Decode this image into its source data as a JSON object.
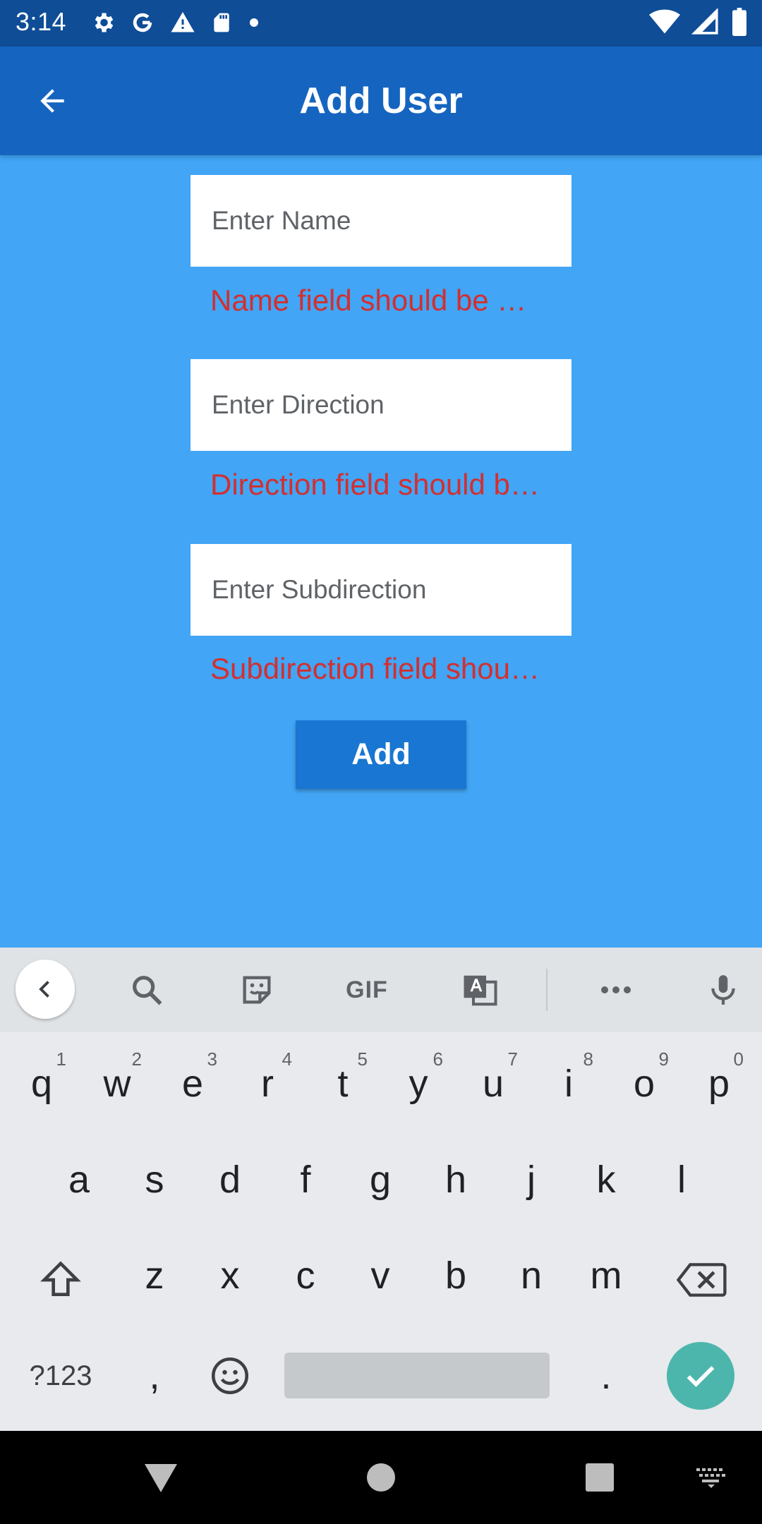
{
  "status_bar": {
    "time": "3:14",
    "left_icons": [
      "gear-icon",
      "google-g-icon",
      "warning-icon",
      "sd-card-icon",
      "dot-icon"
    ],
    "right_icons": [
      "wifi-icon",
      "signal-icon",
      "battery-icon"
    ]
  },
  "app_bar": {
    "title": "Add User",
    "back_icon": "arrow-back-icon"
  },
  "form": {
    "name": {
      "placeholder": "Enter Name",
      "value": "",
      "error": "Name field should be …"
    },
    "direction": {
      "placeholder": "Enter Direction",
      "value": "",
      "error": "Direction field should b…"
    },
    "subdirection": {
      "placeholder": "Enter Subdirection",
      "value": "",
      "error": "Subdirection field shou…"
    },
    "add_label": "Add"
  },
  "colors": {
    "status_bar": "#0F4D97",
    "app_bar": "#1565C0",
    "background": "#42A5F5",
    "button": "#1976D2",
    "error": "#D32F2F",
    "enter_key": "#4DB6AC"
  },
  "keyboard": {
    "toolbar": {
      "items": [
        "back-chevron-icon",
        "search-icon",
        "sticker-icon",
        "GIF",
        "translate-icon",
        "more-icon",
        "mic-icon"
      ],
      "gif_label": "GIF"
    },
    "row1": [
      "q",
      "w",
      "e",
      "r",
      "t",
      "y",
      "u",
      "i",
      "o",
      "p"
    ],
    "row1_hints": [
      "1",
      "2",
      "3",
      "4",
      "5",
      "6",
      "7",
      "8",
      "9",
      "0"
    ],
    "row2": [
      "a",
      "s",
      "d",
      "f",
      "g",
      "h",
      "j",
      "k",
      "l"
    ],
    "row3": [
      "z",
      "x",
      "c",
      "v",
      "b",
      "n",
      "m"
    ],
    "symbols_label": "?123",
    "comma": ",",
    "period": "."
  },
  "nav_bar": {
    "buttons": [
      "back-triangle-icon",
      "home-circle-icon",
      "recents-square-icon",
      "keyboard-switch-icon"
    ]
  }
}
